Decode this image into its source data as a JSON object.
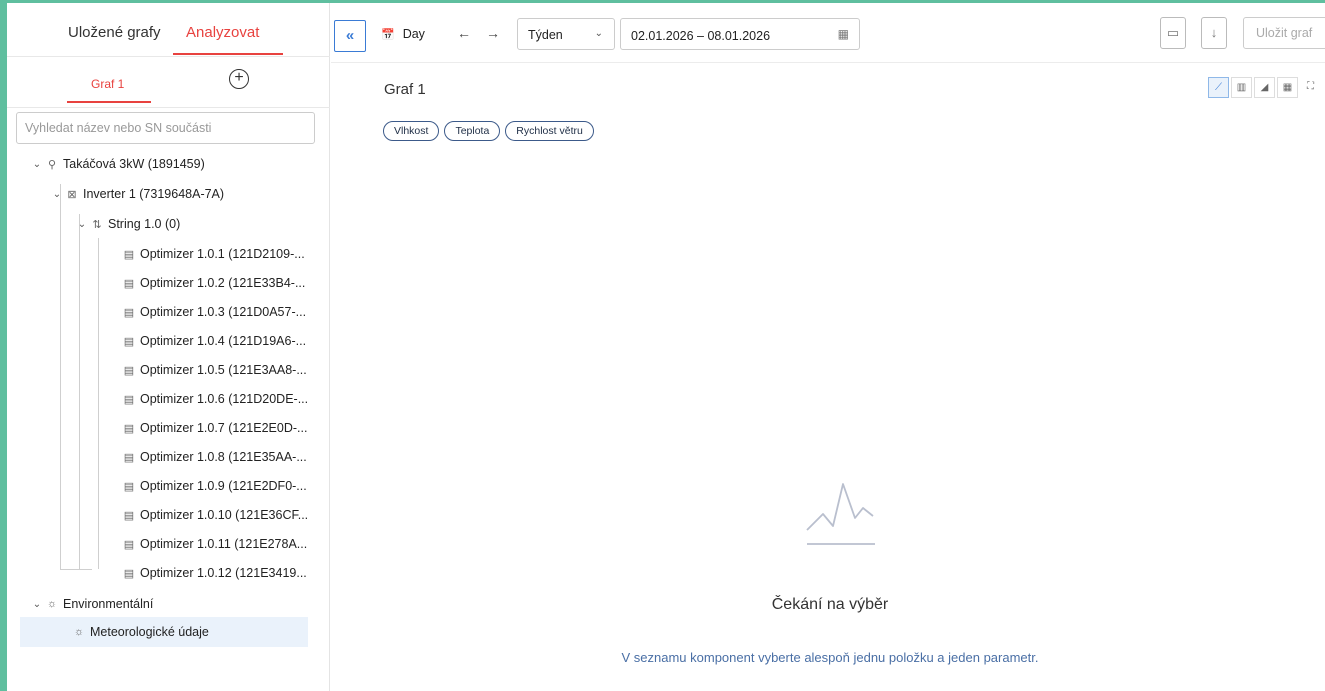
{
  "sidebar": {
    "tabs": [
      {
        "label": "Uložené grafy"
      },
      {
        "label": "Analyzovat"
      }
    ],
    "graph_tab": "Graf 1",
    "add_graph_icon": "plus-circle-icon",
    "search_placeholder": "Vyhledat název nebo SN součásti",
    "tree": [
      {
        "label": "Takáčová 3kW (1891459)",
        "icon": "map-pin-icon"
      },
      {
        "label": "Inverter 1 (7319648A-7A)",
        "icon": "inverter-icon"
      },
      {
        "label": "String 1.0 (0)",
        "icon": "string-icon"
      },
      {
        "label": "Optimizer 1.0.1 (121D2109-...",
        "icon": "optimizer-icon"
      },
      {
        "label": "Optimizer 1.0.2 (121E33B4-...",
        "icon": "optimizer-icon"
      },
      {
        "label": "Optimizer 1.0.3 (121D0A57-...",
        "icon": "optimizer-icon"
      },
      {
        "label": "Optimizer 1.0.4 (121D19A6-...",
        "icon": "optimizer-icon"
      },
      {
        "label": "Optimizer 1.0.5 (121E3AA8-...",
        "icon": "optimizer-icon"
      },
      {
        "label": "Optimizer 1.0.6 (121D20DE-...",
        "icon": "optimizer-icon"
      },
      {
        "label": "Optimizer 1.0.7 (121E2E0D-...",
        "icon": "optimizer-icon"
      },
      {
        "label": "Optimizer 1.0.8 (121E35AA-...",
        "icon": "optimizer-icon"
      },
      {
        "label": "Optimizer 1.0.9 (121E2DF0-...",
        "icon": "optimizer-icon"
      },
      {
        "label": "Optimizer 1.0.10 (121E36CF...",
        "icon": "optimizer-icon"
      },
      {
        "label": "Optimizer 1.0.11 (121E278A...",
        "icon": "optimizer-icon"
      },
      {
        "label": "Optimizer 1.0.12 (121E3419...",
        "icon": "optimizer-icon"
      },
      {
        "label": "Environmentální",
        "icon": "sun-icon"
      },
      {
        "label": "Meteorologické údaje",
        "icon": "sun-icon"
      }
    ]
  },
  "toolbar": {
    "collapse_label": "«",
    "period_label": "Day",
    "period_icon": "calendar-icon",
    "back_icon": "arrow-left-icon",
    "forward_icon": "arrow-right-icon",
    "range_select": "Týden",
    "date_range": "02.01.2026 – 08.01.2026",
    "export_image_icon": "image-icon",
    "download_icon": "download-icon",
    "save_label": "Uložit graf"
  },
  "main": {
    "title": "Graf 1",
    "view_modes": [
      "line-chart-icon",
      "bar-chart-icon",
      "area-chart-icon",
      "table-icon",
      "expand-icon"
    ],
    "chips": [
      "Vlhkost",
      "Teplota",
      "Rychlost větru"
    ],
    "empty_state": {
      "icon": "chart-placeholder-icon",
      "title": "Čekání na výběr",
      "text": "V seznamu komponent vyberte alespoň jednu položku a jeden parametr."
    }
  },
  "colors": {
    "accent": "#e8423f",
    "primary": "#3a7bd5",
    "frame": "#5fbf9f",
    "selected_bg": "#eaf2fb"
  }
}
